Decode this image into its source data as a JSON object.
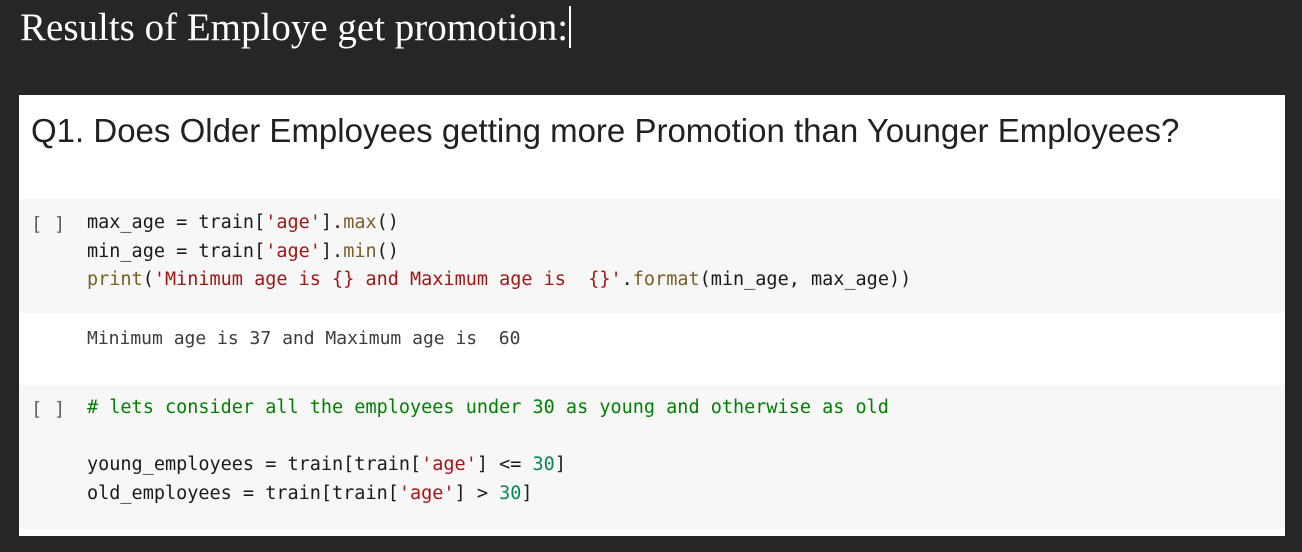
{
  "slide": {
    "title": "Results of Employe get promotion:"
  },
  "notebook": {
    "question_heading": "Q1. Does Older Employees getting more Promotion than Younger Employees?",
    "cells": [
      {
        "run_indicator": "[ ]",
        "lines": [
          [
            {
              "t": "max_age = train[",
              "c": "plain"
            },
            {
              "t": "'age'",
              "c": "str"
            },
            {
              "t": "].",
              "c": "plain"
            },
            {
              "t": "max",
              "c": "fn"
            },
            {
              "t": "()",
              "c": "plain"
            }
          ],
          [
            {
              "t": "min_age = train[",
              "c": "plain"
            },
            {
              "t": "'age'",
              "c": "str"
            },
            {
              "t": "].",
              "c": "plain"
            },
            {
              "t": "min",
              "c": "fn"
            },
            {
              "t": "()",
              "c": "plain"
            }
          ],
          [
            {
              "t": "print",
              "c": "kw"
            },
            {
              "t": "(",
              "c": "plain"
            },
            {
              "t": "'Minimum age is {} and Maximum age is  {}'",
              "c": "str"
            },
            {
              "t": ".",
              "c": "plain"
            },
            {
              "t": "format",
              "c": "fn"
            },
            {
              "t": "(min_age, max_age))",
              "c": "plain"
            }
          ]
        ],
        "output": "Minimum age is 37 and Maximum age is  60"
      },
      {
        "run_indicator": "[ ]",
        "lines": [
          [
            {
              "t": "# lets consider all the employees under 30 as young and otherwise as old",
              "c": "com"
            }
          ],
          [],
          [
            {
              "t": "young_employees = train[train[",
              "c": "plain"
            },
            {
              "t": "'age'",
              "c": "str"
            },
            {
              "t": "] <= ",
              "c": "plain"
            },
            {
              "t": "30",
              "c": "num"
            },
            {
              "t": "]",
              "c": "plain"
            }
          ],
          [
            {
              "t": "old_employees = train[train[",
              "c": "plain"
            },
            {
              "t": "'age'",
              "c": "str"
            },
            {
              "t": "] > ",
              "c": "plain"
            },
            {
              "t": "30",
              "c": "num"
            },
            {
              "t": "]",
              "c": "plain"
            }
          ]
        ]
      }
    ]
  },
  "colors": {
    "slide_background": "#262626",
    "string": "#a31515",
    "function": "#795e26",
    "number": "#098658",
    "comment": "#008000",
    "cell_background": "#f7f7f7"
  }
}
